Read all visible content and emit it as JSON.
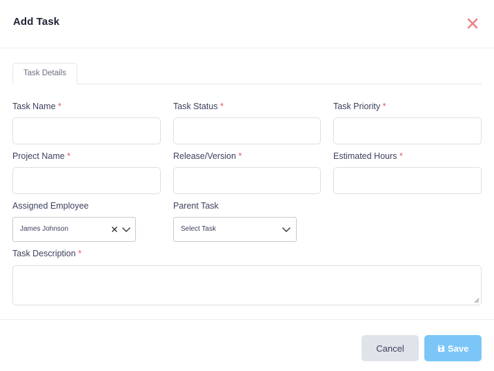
{
  "modal": {
    "title": "Add Task",
    "close_icon": "close-icon"
  },
  "tabs": [
    {
      "label": "Task Details",
      "active": true
    }
  ],
  "fields": {
    "task_name": {
      "label": "Task Name",
      "required": "*",
      "value": ""
    },
    "task_status": {
      "label": "Task Status",
      "required": "*",
      "value": ""
    },
    "task_priority": {
      "label": "Task Priority",
      "required": "*",
      "value": ""
    },
    "project_name": {
      "label": "Project Name",
      "required": "*",
      "value": ""
    },
    "release_version": {
      "label": "Release/Version",
      "required": "*",
      "value": ""
    },
    "estimated_hours": {
      "label": "Estimated Hours",
      "required": "*",
      "value": ""
    },
    "assigned_employee": {
      "label": "Assigned Employee",
      "selected": "James Johnson"
    },
    "parent_task": {
      "label": "Parent Task",
      "placeholder": "Select Task"
    },
    "task_description": {
      "label": "Task Description",
      "required": "*",
      "value": ""
    }
  },
  "footer": {
    "cancel_label": "Cancel",
    "save_label": "Save"
  },
  "colors": {
    "required": "#e7515a",
    "close": "#e7515a",
    "save_button": "#7cc6f7",
    "cancel_button": "#e1e3ea"
  }
}
